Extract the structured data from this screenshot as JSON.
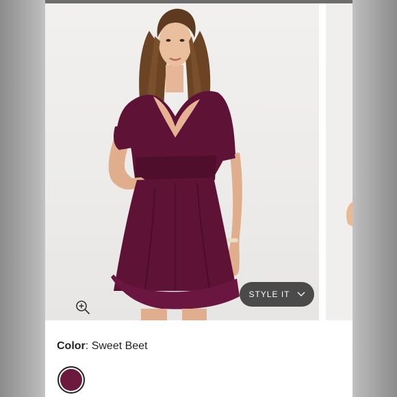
{
  "product": {
    "style_button_label": "STYLE IT",
    "color_label": "Color",
    "color_separator": ":",
    "color_name": "Sweet Beet",
    "swatch_color": "#6b1a3e",
    "dress_color": "#5e1236"
  },
  "icons": {
    "zoom": "zoom-in-icon",
    "style_chevron": "chevron-down-icon"
  }
}
